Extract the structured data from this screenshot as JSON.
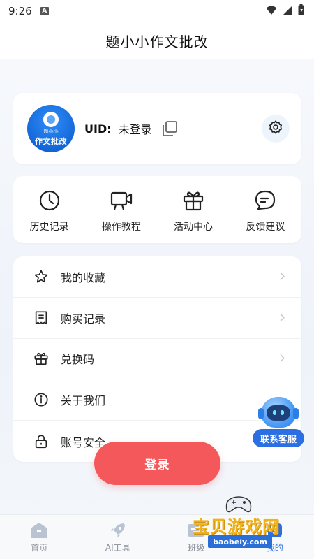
{
  "status_bar": {
    "time": "9:26",
    "notification_letter": "A"
  },
  "header": {
    "title": "题小小作文批改"
  },
  "profile": {
    "avatar_small_text": "题小小",
    "avatar_text": "作文批改",
    "uid_label": "UID:",
    "uid_value": "未登录"
  },
  "quick_actions": [
    {
      "label": "历史记录",
      "icon": "clock-icon"
    },
    {
      "label": "操作教程",
      "icon": "video-icon"
    },
    {
      "label": "活动中心",
      "icon": "gift-icon"
    },
    {
      "label": "反馈建议",
      "icon": "chat-icon"
    }
  ],
  "menu": [
    {
      "label": "我的收藏",
      "icon": "star-icon"
    },
    {
      "label": "购买记录",
      "icon": "receipt-icon"
    },
    {
      "label": "兑换码",
      "icon": "gift-icon"
    },
    {
      "label": "关于我们",
      "icon": "info-icon"
    },
    {
      "label": "账号安全",
      "icon": "lock-icon"
    }
  ],
  "login_button": "登录",
  "service": {
    "label": "联系客服"
  },
  "tabs": [
    {
      "label": "首页",
      "icon": "home-icon"
    },
    {
      "label": "AI工具",
      "icon": "rocket-icon"
    },
    {
      "label": "班级",
      "icon": "class-icon"
    },
    {
      "label": "我的",
      "icon": "user-icon",
      "active": true
    }
  ],
  "watermark": {
    "text": "宝贝游戏网",
    "url": "baobeiy.com"
  },
  "colors": {
    "accent": "#2c6fe3",
    "login": "#f5585a",
    "background": "#f3f7fc"
  }
}
